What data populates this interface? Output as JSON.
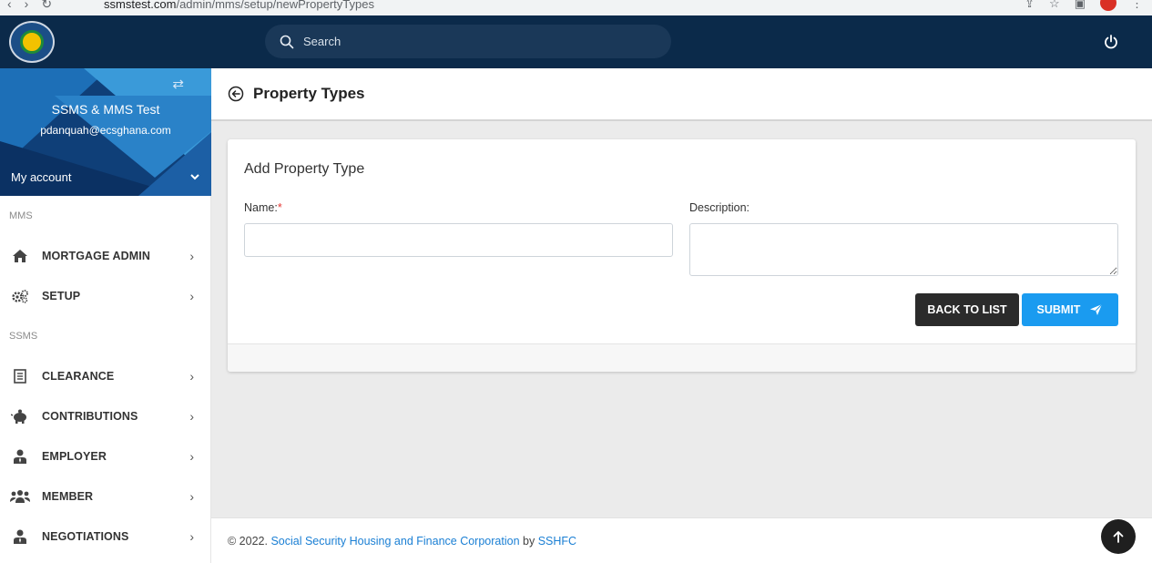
{
  "browser": {
    "url_host": "ssmstest.com",
    "url_path": "/admin/mms/setup/newPropertyTypes"
  },
  "topbar": {
    "search_placeholder": "Search"
  },
  "profile": {
    "name": "SSMS & MMS Test",
    "email": "pdanquah@ecsghana.com",
    "my_account": "My account"
  },
  "sidebar": {
    "section_mms": "MMS",
    "section_ssms": "SSMS",
    "mms_items": [
      {
        "label": "MORTGAGE ADMIN",
        "icon": "home-icon"
      },
      {
        "label": "SETUP",
        "icon": "cogs-icon"
      }
    ],
    "ssms_items": [
      {
        "label": "CLEARANCE",
        "icon": "document-icon"
      },
      {
        "label": "CONTRIBUTIONS",
        "icon": "piggy-bank-icon"
      },
      {
        "label": "EMPLOYER",
        "icon": "user-tie-icon"
      },
      {
        "label": "MEMBER",
        "icon": "users-icon"
      },
      {
        "label": "NEGOTIATIONS",
        "icon": "user-tie-icon"
      }
    ]
  },
  "header": {
    "title": "Property Types"
  },
  "form": {
    "title": "Add Property Type",
    "name_label": "Name:",
    "required_mark": "*",
    "description_label": "Description:",
    "name_value": "",
    "description_value": "",
    "back_button": "BACK TO LIST",
    "submit_button": "SUBMIT"
  },
  "footer": {
    "prefix": "© 2022.",
    "org_link": "Social Security Housing and Finance Corporation",
    "by": "by",
    "brand_link": "SSHFC"
  },
  "colors": {
    "topbar": "#0b2a4a",
    "accent": "#1a9bf0",
    "dark_button": "#2b2b2b",
    "link": "#1a7fd4"
  }
}
